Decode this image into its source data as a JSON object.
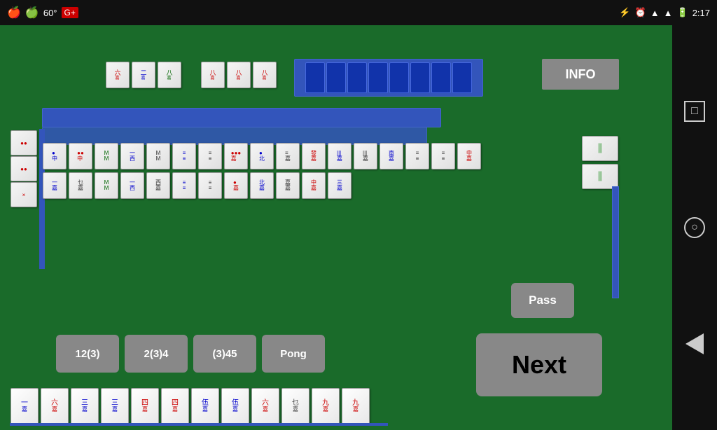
{
  "statusBar": {
    "leftIcons": [
      "🍎",
      "🍏"
    ],
    "temp": "60°",
    "gplus": "G+",
    "bluetooth": "BT",
    "alarm": "⏰",
    "signal": "📶",
    "battery": "🔋",
    "time": "2:17"
  },
  "infoButton": "INFO",
  "passButton": "Pass",
  "nextButton": "Next",
  "actionButtons": [
    {
      "id": "btn-12-3",
      "label": "12(3)"
    },
    {
      "id": "btn-2-3-4",
      "label": "2(3)4"
    },
    {
      "id": "btn-3-45",
      "label": "(3)45"
    },
    {
      "id": "btn-pong",
      "label": "Pong"
    }
  ],
  "navIcons": {
    "square": "□",
    "circle": "○",
    "back": "◁"
  },
  "playerTiles": [
    "一",
    "六",
    "三",
    "三",
    "四",
    "四",
    "伍",
    "伍",
    "六",
    "乜",
    "九",
    "九"
  ]
}
